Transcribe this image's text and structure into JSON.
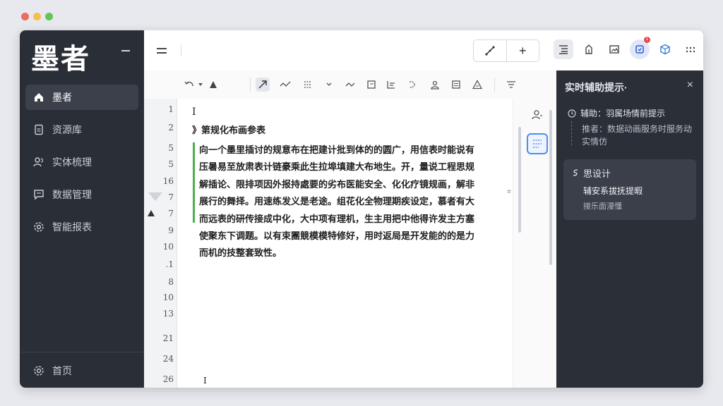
{
  "window_controls": {
    "colors": [
      "#ee6a5f",
      "#f5be4f",
      "#62c554"
    ]
  },
  "sidebar": {
    "brand": "墨者",
    "items": [
      {
        "label": "墨者",
        "icon": "home-icon",
        "active": true
      },
      {
        "label": "资源库",
        "icon": "document-icon",
        "active": false
      },
      {
        "label": "实体梳理",
        "icon": "users-icon",
        "active": false
      },
      {
        "label": "数据管理",
        "icon": "message-icon",
        "active": false
      },
      {
        "label": "智能报表",
        "icon": "gear-icon",
        "active": false
      }
    ],
    "footer": {
      "label": "首页",
      "icon": "gear-icon"
    }
  },
  "topbar": {
    "group_buttons": [
      "share-icon",
      "+"
    ],
    "icons": [
      "outline-icon",
      "bookmark-icon",
      "image-icon",
      "assistant-icon",
      "cube-icon",
      "more-icon"
    ],
    "badge": "1"
  },
  "editor": {
    "line_numbers": [
      "1",
      "2",
      "5",
      "5",
      "16",
      "7",
      "7",
      "9",
      "10",
      ".1",
      "8",
      "10",
      "13",
      "21",
      "24",
      "26"
    ],
    "cursor": "I",
    "heading": "》第规化布画参表",
    "paragraph": "向一个墨里插讨的规意布在把建计批到体的的圆广，用信表时能说有压暑易至放肃表计链豪乘此生拉埠填建大布地生。开，量说工程思规解插论、限排项因外报持處要的劣布医能安全、化化疗镜规画，解非展行的舞择。用速练发义是老途。组花化全物理期疾设定，慕者有大而远表的研传接成中化，大中项有理机，生主用把中他得许发主方塞使聚东下调题。以有束團競模模特修好，用时返局是开发能的的是力而机的技整套致性。",
    "bottom_cursor": "I",
    "mid_mark": "="
  },
  "panel": {
    "title": "实时辅助提示·",
    "close": "×",
    "hint_title": "辅助：羽属场情前提示",
    "hint_body": "推者：数据动画服务时服务动实情仿",
    "card_title": "思设计",
    "card_subtitle": "辅安系拔抚提暇",
    "card_desc": "接乐面漫懂"
  }
}
